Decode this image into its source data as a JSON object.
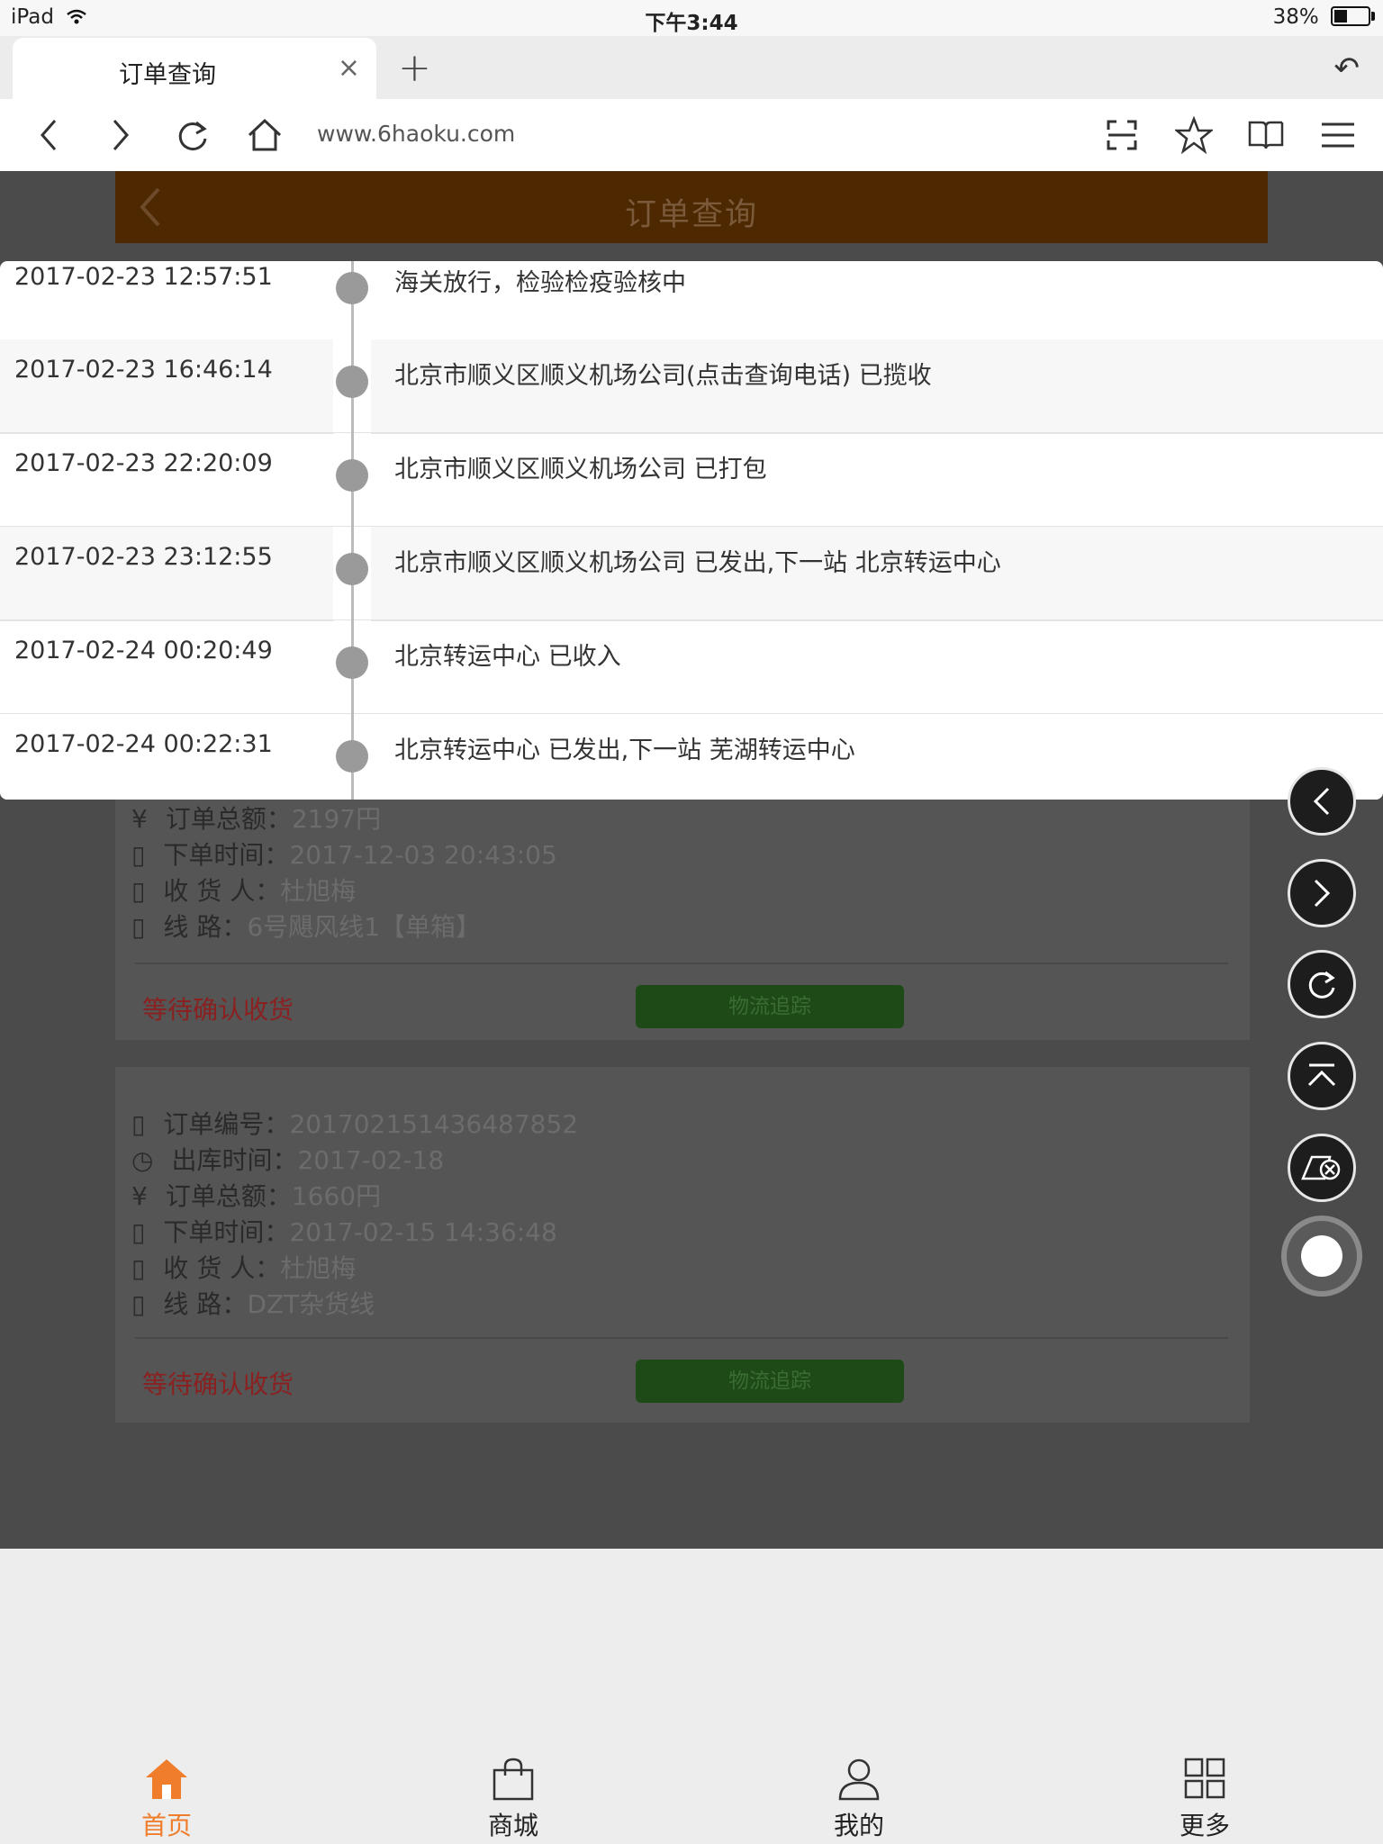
{
  "status_bar": {
    "device": "iPad",
    "time": "下午3:44",
    "battery": "38%"
  },
  "tab": {
    "title": "订单查询",
    "close": "×",
    "new_tab": "+",
    "undo": "↶"
  },
  "nav": {
    "url": "www.6haoku.com"
  },
  "page": {
    "title": "订单查询"
  },
  "tracking": [
    {
      "time": "2017-02-23 12:57:51",
      "desc": "海关放行，检验检疫验核中"
    },
    {
      "time": "2017-02-23 16:46:14",
      "desc": "北京市顺义区顺义机场公司(点击查询电话) 已揽收"
    },
    {
      "time": "2017-02-23 22:20:09",
      "desc": "北京市顺义区顺义机场公司 已打包"
    },
    {
      "time": "2017-02-23 23:12:55",
      "desc": "北京市顺义区顺义机场公司 已发出,下一站 北京转运中心"
    },
    {
      "time": "2017-02-24 00:20:49",
      "desc": "北京转运中心 已收入"
    },
    {
      "time": "2017-02-24 00:22:31",
      "desc": "北京转运中心 已发出,下一站 芜湖转运中心"
    }
  ],
  "orders": [
    {
      "lines": [
        {
          "icon": "¥",
          "label": "订单总额：",
          "value": "2197円"
        },
        {
          "icon": "▯",
          "label": "下单时间：",
          "value": "2017-12-03 20:43:05"
        },
        {
          "icon": "▯",
          "label": "收 货 人：",
          "value": "杜旭梅"
        },
        {
          "icon": "▯",
          "label": "线      路：",
          "value": "6号飓风线1【单箱】"
        }
      ],
      "status": "等待确认收货",
      "track_button": "物流追踪"
    },
    {
      "lines": [
        {
          "icon": "▯",
          "label": "订单编号：",
          "value": "201702151436487852"
        },
        {
          "icon": "◷",
          "label": "出库时间：",
          "value": "2017-02-18"
        },
        {
          "icon": "¥",
          "label": "订单总额：",
          "value": "1660円"
        },
        {
          "icon": "▯",
          "label": "下单时间：",
          "value": "2017-02-15 14:36:48"
        },
        {
          "icon": "▯",
          "label": "收 货 人：",
          "value": "杜旭梅"
        },
        {
          "icon": "▯",
          "label": "线      路：",
          "value": "DZT杂货线"
        }
      ],
      "status": "等待确认收货",
      "track_button": "物流追踪"
    }
  ],
  "bottom_nav": [
    {
      "label": "首页",
      "icon": "home-icon",
      "active": true
    },
    {
      "label": "商城",
      "icon": "shopping-bag-icon"
    },
    {
      "label": "我的",
      "icon": "user-icon"
    },
    {
      "label": "更多",
      "icon": "grid-icon"
    }
  ],
  "colors": {
    "accent": "#f07d2c",
    "header": "#4e2800",
    "status_red": "#8b2020",
    "track_green": "#1e4a17"
  }
}
